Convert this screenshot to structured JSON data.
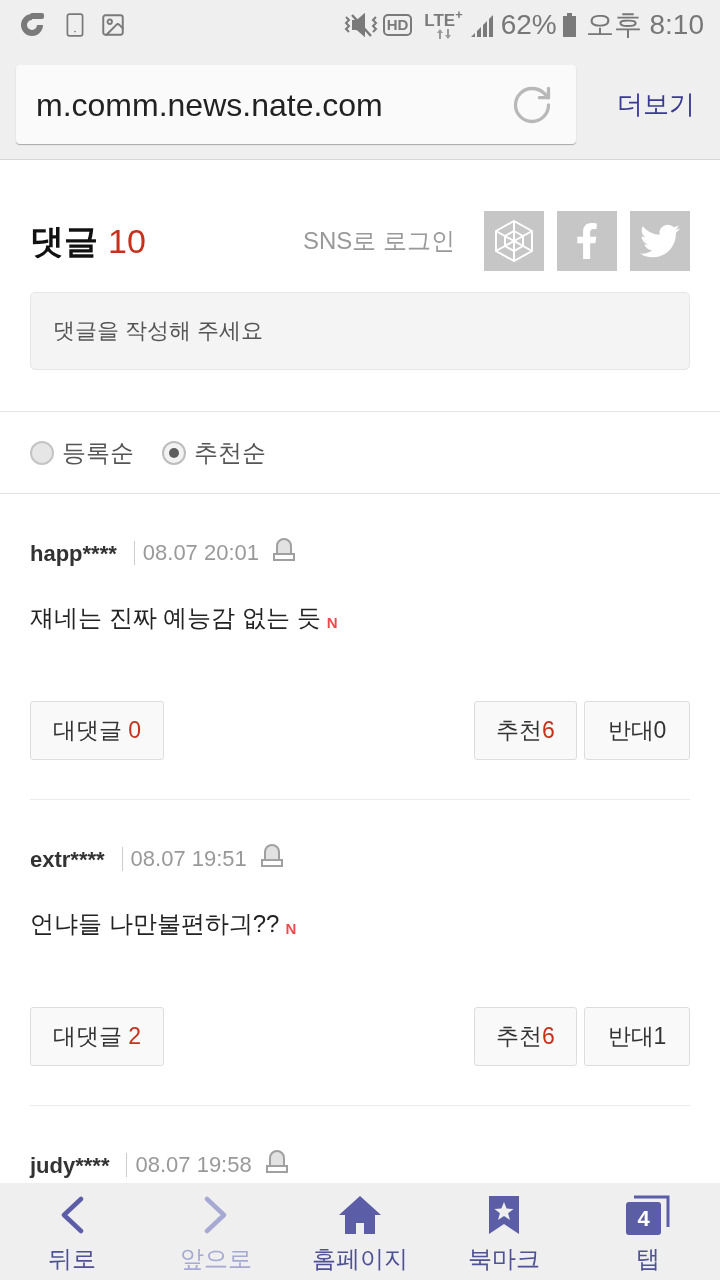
{
  "status_bar": {
    "hd": "HD",
    "network": "LTE$^{+}$",
    "battery": "62%",
    "time": "오후 8:10"
  },
  "browser": {
    "url": "m.comm.news.nate.com",
    "menu": "더보기"
  },
  "comments_header": {
    "title": "댓글",
    "count": "10",
    "sns_login": "SNS로 로그인"
  },
  "sns_buttons": [
    {
      "kind": "hexagon"
    },
    {
      "kind": "facebook"
    },
    {
      "kind": "twitter"
    }
  ],
  "comment_input": {
    "placeholder": "댓글을 작성해 주세요"
  },
  "sort_options": [
    {
      "label": "등록순",
      "selected": false
    },
    {
      "label": "추천순",
      "selected": true
    }
  ],
  "comments": [
    {
      "user": "happ****",
      "date": "08.07 20:01",
      "text": "쟤네는 진짜 예능감 없는 듯",
      "new_mark": "N",
      "reply_label": "대댓글",
      "reply_count": "0",
      "up_label": "추천",
      "up_count": "6",
      "down_label": "반대",
      "down_count": "0"
    },
    {
      "user": "extr****",
      "date": "08.07 19:51",
      "text": "언냐들 나만불편하긔??",
      "new_mark": "N",
      "reply_label": "대댓글",
      "reply_count": "2",
      "up_label": "추천",
      "up_count": "6",
      "down_label": "반대",
      "down_count": "1"
    },
    {
      "user": "judy****",
      "date": "08.07 19:58"
    }
  ],
  "toolbar": [
    {
      "kind": "back",
      "label": "뒤로",
      "disabled": false
    },
    {
      "kind": "forward",
      "label": "앞으로",
      "disabled": true
    },
    {
      "kind": "home",
      "label": "홈페이지",
      "disabled": false
    },
    {
      "kind": "bookmark",
      "label": "북마크",
      "disabled": false
    },
    {
      "kind": "tabs",
      "label": "탭",
      "count": "4",
      "disabled": false
    }
  ]
}
